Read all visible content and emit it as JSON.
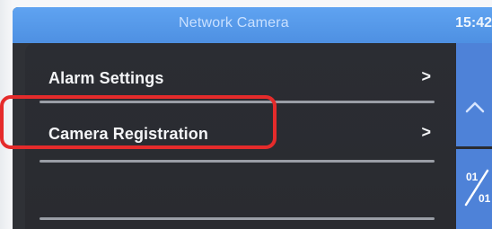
{
  "header": {
    "title": "Network Camera",
    "time": "15:42"
  },
  "menu": {
    "items": [
      {
        "label": "Alarm Settings",
        "chevron": ">"
      },
      {
        "label": "Camera Registration",
        "chevron": ">"
      }
    ]
  },
  "side": {
    "up_icon": "chevron-up-icon",
    "page_current": "01",
    "page_total": "01"
  },
  "colors": {
    "header_blue": "#5fa3f1",
    "side_blue": "#4e82d8",
    "highlight_red": "#e52b2b",
    "panel_dark": "#2b2d33"
  }
}
